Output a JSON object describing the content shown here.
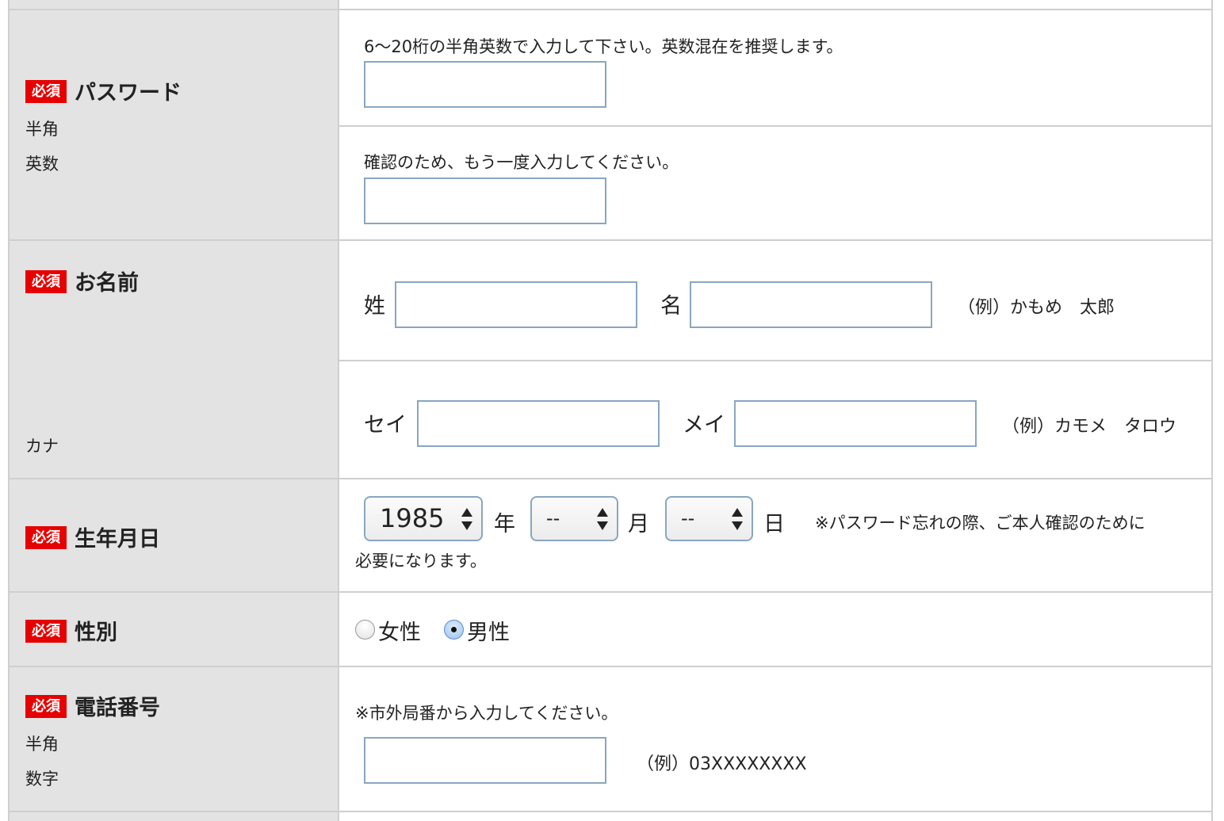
{
  "required_badge": "必須",
  "password": {
    "title": "パスワード",
    "sub1": "半角",
    "sub2": "英数",
    "hint1": "6〜20桁の半角英数で入力して下さい。英数混在を推奨します。",
    "hint2": "確認のため、もう一度入力してください。",
    "value1": "",
    "value2": ""
  },
  "name": {
    "title": "お名前",
    "kana_label": "カナ",
    "sei_label": "姓",
    "mei_label": "名",
    "example": "（例）かもめ　太郎",
    "kana_sei_label": "セイ",
    "kana_mei_label": "メイ",
    "kana_example": "（例）カモメ　タロウ",
    "sei_value": "",
    "mei_value": "",
    "kana_sei_value": "",
    "kana_mei_value": ""
  },
  "birthday": {
    "title": "生年月日",
    "year_value": "1985",
    "year_unit": "年",
    "month_value": "--",
    "month_unit": "月",
    "day_value": "--",
    "day_unit": "日",
    "note_line1": "※パスワード忘れの際、ご本人確認のために",
    "note_line2": "必要になります。"
  },
  "gender": {
    "title": "性別",
    "female_label": "女性",
    "male_label": "男性",
    "selected": "male"
  },
  "phone": {
    "title": "電話番号",
    "sub1": "半角",
    "sub2": "数字",
    "hint": "※市外局番から入力してください。",
    "example": "（例）03XXXXXXXX",
    "value": ""
  },
  "colors": {
    "required_badge_bg": "#e60000",
    "label_cell_bg": "#e3e3e3",
    "input_border": "#8aa6c1",
    "grid_border": "#cfcfcf"
  }
}
